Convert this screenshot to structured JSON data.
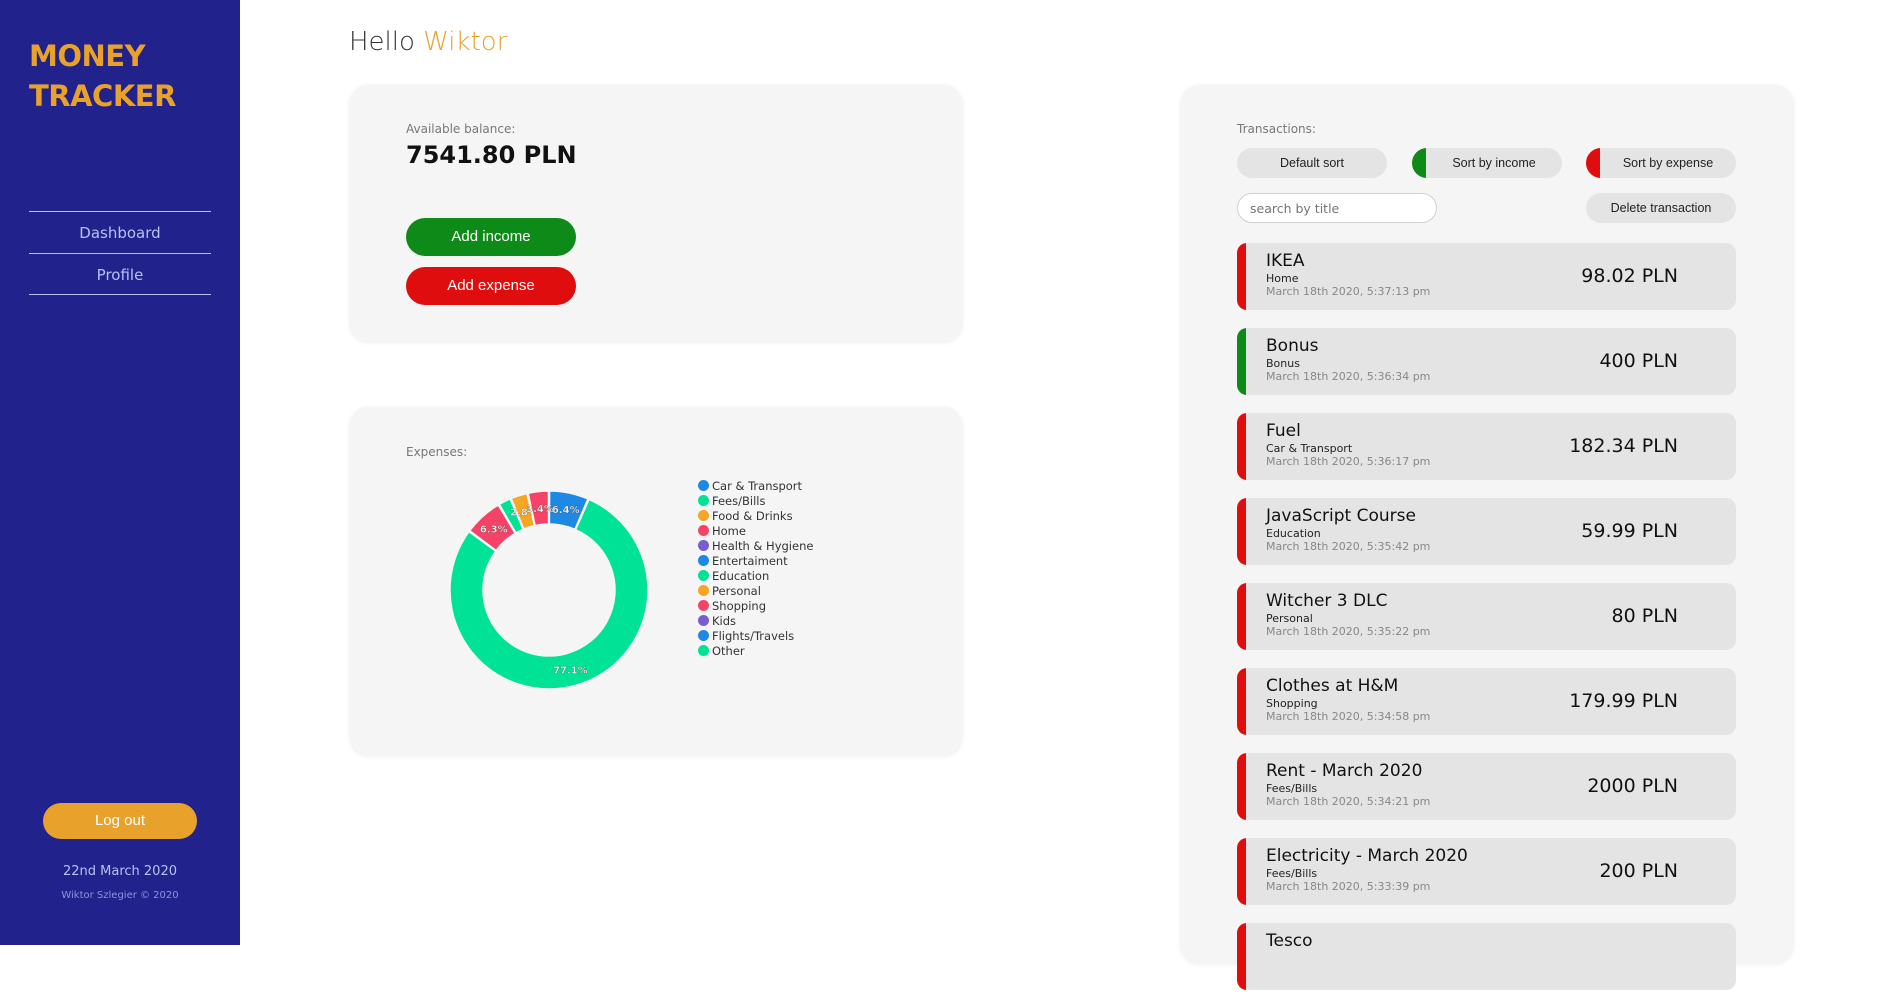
{
  "sidebar": {
    "logo_line1": "MONEY",
    "logo_line2": "TRACKER",
    "nav": [
      {
        "label": "Dashboard"
      },
      {
        "label": "Profile"
      }
    ],
    "logout_label": "Log out",
    "date": "22nd March 2020",
    "copyright": "Wiktor Szlegier © 2020"
  },
  "header": {
    "greeting": "Hello",
    "user_name": "Wiktor"
  },
  "balance": {
    "label": "Available balance:",
    "value": "7541.80 PLN",
    "add_income_label": "Add income",
    "add_expense_label": "Add expense"
  },
  "expenses": {
    "label": "Expenses:"
  },
  "chart_data": {
    "type": "pie",
    "donut": true,
    "legend_position": "right",
    "categories": [
      "Car & Transport",
      "Fees/Bills",
      "Food & Drinks",
      "Home",
      "Health & Hygiene",
      "Entertaiment",
      "Education",
      "Personal",
      "Shopping",
      "Kids",
      "Flights/Travels",
      "Other"
    ],
    "colors": [
      "#1e88e5",
      "#00e396",
      "#f5a623",
      "#f44366",
      "#775dd0",
      "#1e88e5",
      "#00e396",
      "#f5a623",
      "#f44366",
      "#775dd0",
      "#1e88e5",
      "#00e396"
    ],
    "values": [
      6.4,
      77.1,
      0,
      6.3,
      0,
      0,
      2.1,
      2.8,
      3.4,
      0,
      0,
      0
    ],
    "shown_labels": [
      "6.4%",
      "77.1%",
      "",
      "6.3%",
      "",
      "",
      "",
      "2.8%",
      "3.4%",
      "",
      "",
      ""
    ]
  },
  "transactions": {
    "label": "Transactions:",
    "default_sort_label": "Default sort",
    "sort_income_label": "Sort by income",
    "sort_expense_label": "Sort by expense",
    "search_placeholder": "search by title",
    "delete_label": "Delete transaction",
    "income_color": "#0e8a18",
    "expense_color": "#df0d0d",
    "items": [
      {
        "title": "IKEA",
        "category": "Home",
        "date": "March 18th 2020, 5:37:13 pm",
        "amount": "98.02 PLN",
        "kind": "expense"
      },
      {
        "title": "Bonus",
        "category": "Bonus",
        "date": "March 18th 2020, 5:36:34 pm",
        "amount": "400 PLN",
        "kind": "income"
      },
      {
        "title": "Fuel",
        "category": "Car & Transport",
        "date": "March 18th 2020, 5:36:17 pm",
        "amount": "182.34 PLN",
        "kind": "expense"
      },
      {
        "title": "JavaScript Course",
        "category": "Education",
        "date": "March 18th 2020, 5:35:42 pm",
        "amount": "59.99 PLN",
        "kind": "expense"
      },
      {
        "title": "Witcher 3 DLC",
        "category": "Personal",
        "date": "March 18th 2020, 5:35:22 pm",
        "amount": "80 PLN",
        "kind": "expense"
      },
      {
        "title": "Clothes at H&M",
        "category": "Shopping",
        "date": "March 18th 2020, 5:34:58 pm",
        "amount": "179.99 PLN",
        "kind": "expense"
      },
      {
        "title": "Rent - March 2020",
        "category": "Fees/Bills",
        "date": "March 18th 2020, 5:34:21 pm",
        "amount": "2000 PLN",
        "kind": "expense"
      },
      {
        "title": "Electricity - March 2020",
        "category": "Fees/Bills",
        "date": "March 18th 2020, 5:33:39 pm",
        "amount": "200 PLN",
        "kind": "expense"
      },
      {
        "title": "Tesco",
        "category": "",
        "date": "",
        "amount": "",
        "kind": "expense"
      }
    ]
  }
}
